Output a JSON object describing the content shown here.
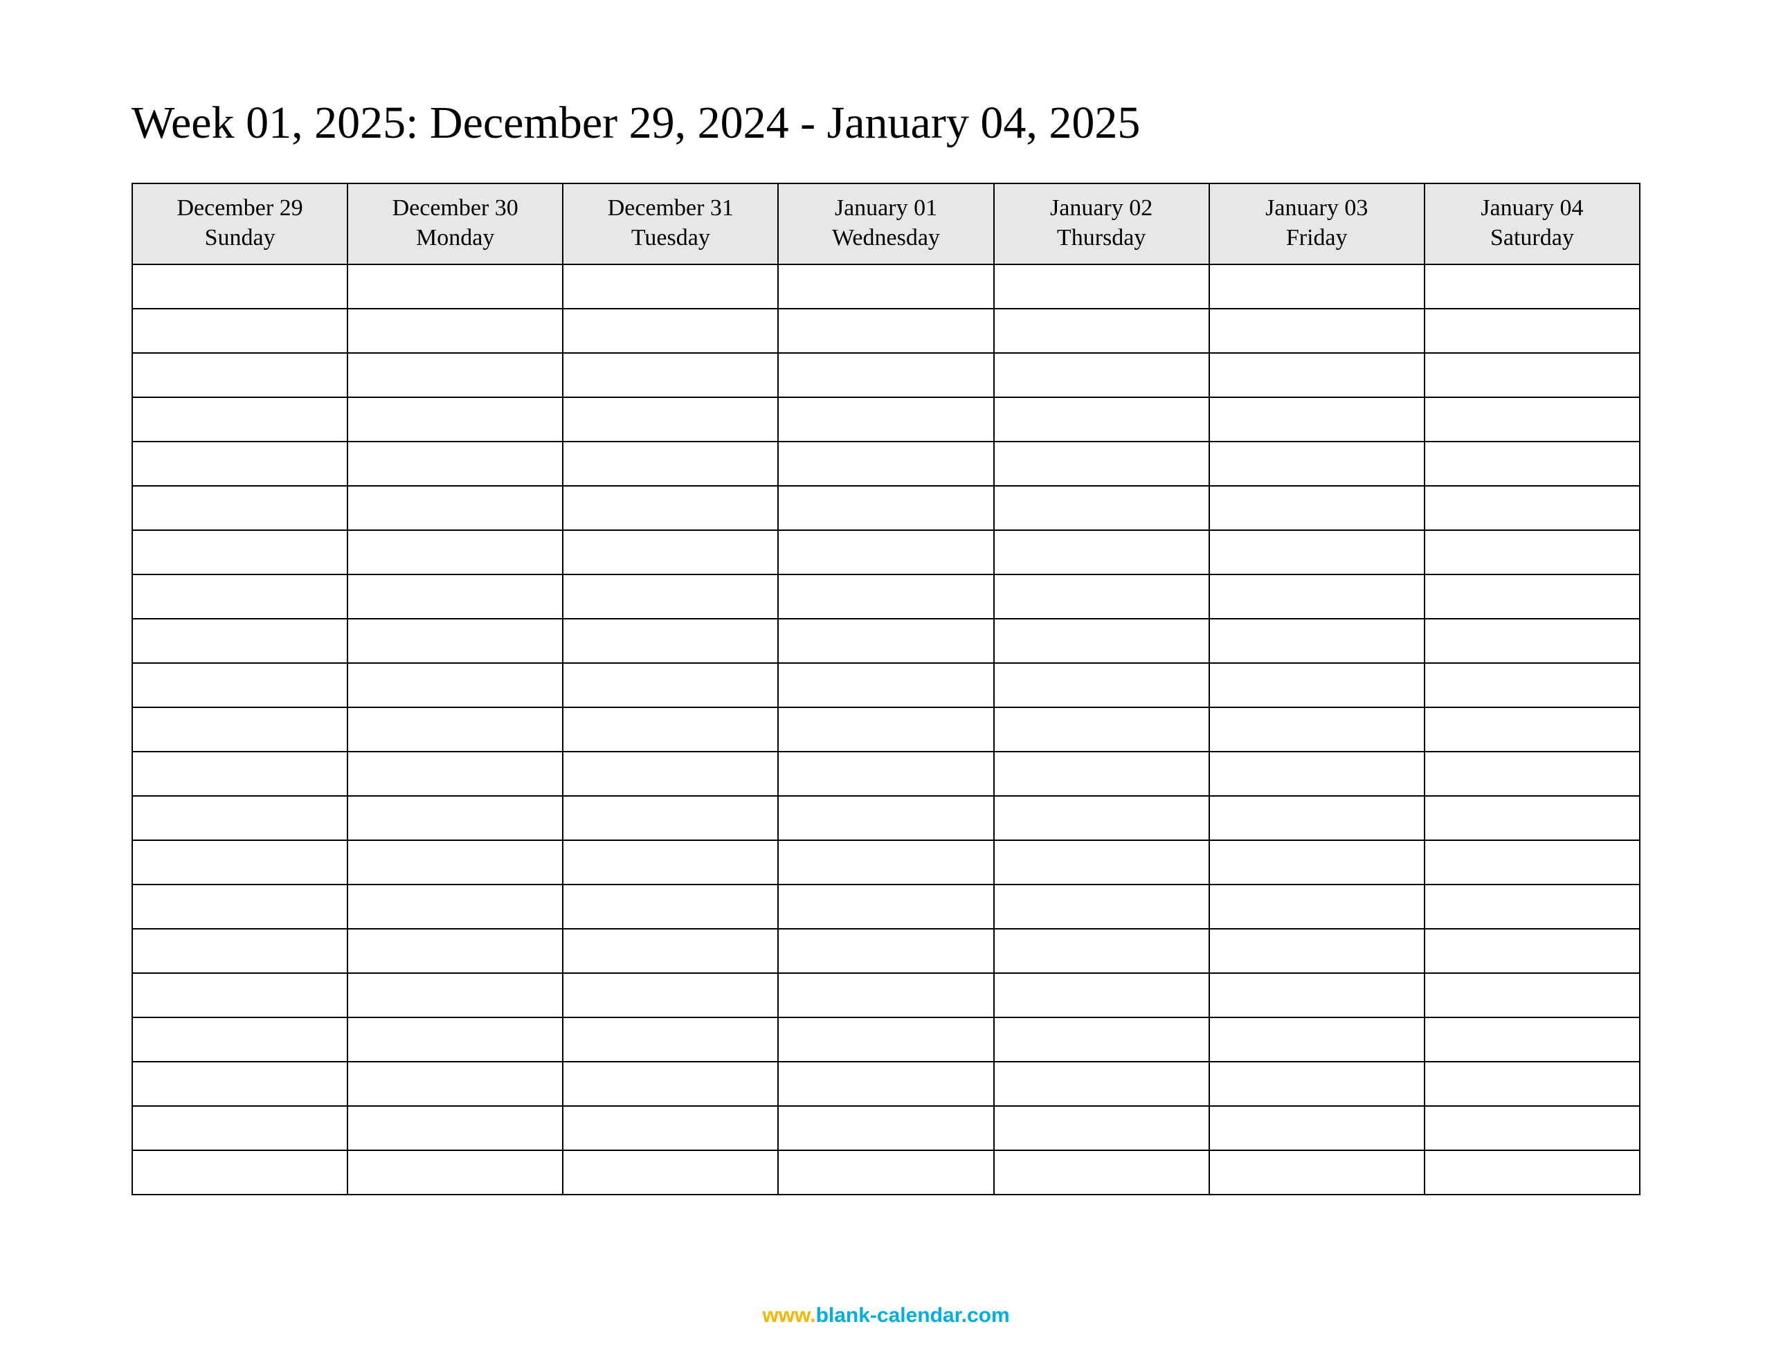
{
  "title": "Week 01, 2025: December 29, 2024 - January 04, 2025",
  "columns": [
    {
      "date": "December 29",
      "day": "Sunday"
    },
    {
      "date": "December 30",
      "day": "Monday"
    },
    {
      "date": "December 31",
      "day": "Tuesday"
    },
    {
      "date": "January 01",
      "day": "Wednesday"
    },
    {
      "date": "January 02",
      "day": "Thursday"
    },
    {
      "date": "January 03",
      "day": "Friday"
    },
    {
      "date": "January 04",
      "day": "Saturday"
    }
  ],
  "row_count": 21,
  "footer": {
    "www": "www.",
    "domain": "blank-calendar.com"
  }
}
